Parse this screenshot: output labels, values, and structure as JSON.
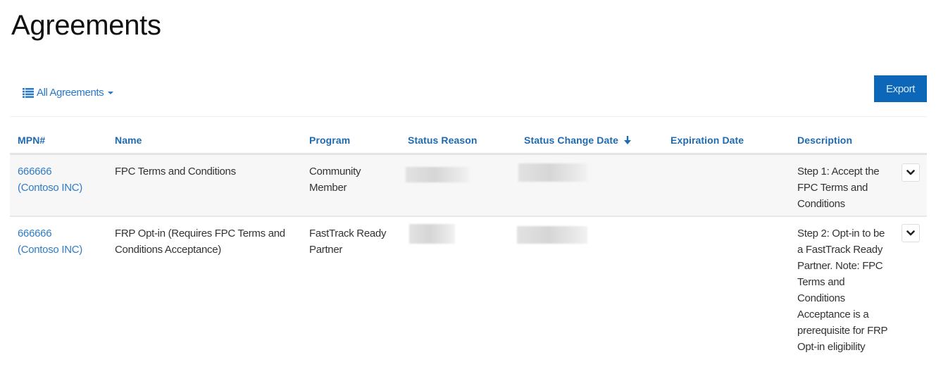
{
  "page": {
    "title": "Agreements"
  },
  "toolbar": {
    "view_selector_label": "All Agreements",
    "view_icon": "list-icon",
    "export_label": "Export"
  },
  "colors": {
    "accent": "#0d67b9",
    "link": "#2f7cc4",
    "header_text": "#1f6ab0",
    "row_alt_bg": "#f7f7f7"
  },
  "table": {
    "columns": [
      {
        "key": "mpn",
        "label": "MPN#"
      },
      {
        "key": "name",
        "label": "Name"
      },
      {
        "key": "program",
        "label": "Program"
      },
      {
        "key": "status_reason",
        "label": "Status Reason"
      },
      {
        "key": "status_change_date",
        "label": "Status Change Date",
        "sorted": "descending"
      },
      {
        "key": "expiration_date",
        "label": "Expiration Date"
      },
      {
        "key": "description",
        "label": "Description"
      }
    ],
    "rows": [
      {
        "mpn_id": "666666",
        "mpn_company": "(Contoso INC)",
        "name": "FPC Terms and Conditions",
        "program": "Community Member",
        "status_reason": "[redacted]",
        "status_change_date": "[redacted]",
        "expiration_date": "",
        "description": "Step 1: Accept the FPC Terms and Conditions"
      },
      {
        "mpn_id": "666666",
        "mpn_company": "(Contoso INC)",
        "name": "FRP Opt-in (Requires FPC Terms and Conditions Acceptance)",
        "program": "FastTrack Ready Partner",
        "status_reason": "[redacted]",
        "status_change_date": "[redacted]",
        "expiration_date": "",
        "description": "Step 2: Opt-in to be a FastTrack Ready Partner. Note: FPC Terms and Conditions Acceptance is a prerequisite for FRP Opt-in eligibility"
      }
    ]
  }
}
